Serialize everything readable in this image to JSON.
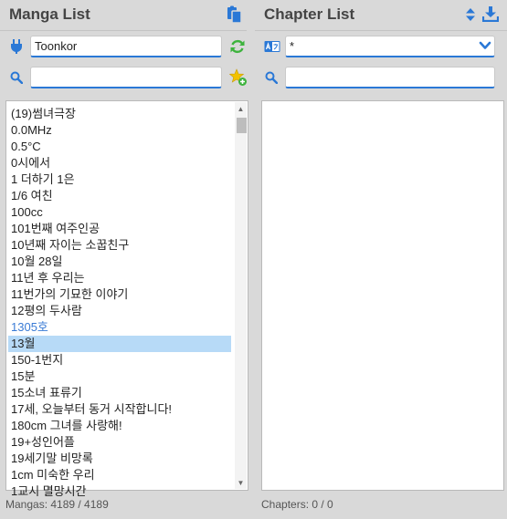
{
  "manga_panel": {
    "title": "Manga List",
    "header_icon": "clipboard-copy-icon",
    "connector": {
      "icon": "plug-icon",
      "value": "Toonkor",
      "refresh_icon": "refresh-icon"
    },
    "search": {
      "icon": "search-icon",
      "value": "",
      "bookmark_icon": "star-add-icon"
    },
    "items": [
      "(19)썸녀극장",
      "0.0MHz",
      "0.5°C",
      "0시에서",
      "1 더하기 1은",
      "1/6 여친",
      "100cc",
      "101번째 여주인공",
      "10년째 자이는 소꿉친구",
      "10월 28일",
      "11년 후 우리는",
      "11번가의 기묘한 이야기",
      "12평의 두사람",
      "1305호",
      "13월",
      "150-1번지",
      "15분",
      "15소녀 표류기",
      "17세, 오늘부터 동거 시작합니다!",
      "180cm 그녀를 사랑해!",
      "19+성인어플",
      "19세기말 비망록",
      "1cm 미숙한 우리",
      "1교시 멸망시간"
    ],
    "hover_index": 13,
    "selected_index": 14,
    "status": "Mangas: 4189 / 4189"
  },
  "chapter_panel": {
    "title": "Chapter List",
    "sort_icon": "sort-arrows-icon",
    "download_icon": "download-icon",
    "language": {
      "icon": "translate-icon",
      "value": "*",
      "dropdown_icon": "chevron-down-icon"
    },
    "search": {
      "icon": "search-icon",
      "value": ""
    },
    "items": [],
    "status": "Chapters: 0 / 0"
  },
  "colors": {
    "accent": "#2a78d6",
    "selected_bg": "#b7daf7",
    "hover_text": "#3a7bd5",
    "refresh_green": "#3db33d",
    "star_yellow": "#f2c200"
  }
}
